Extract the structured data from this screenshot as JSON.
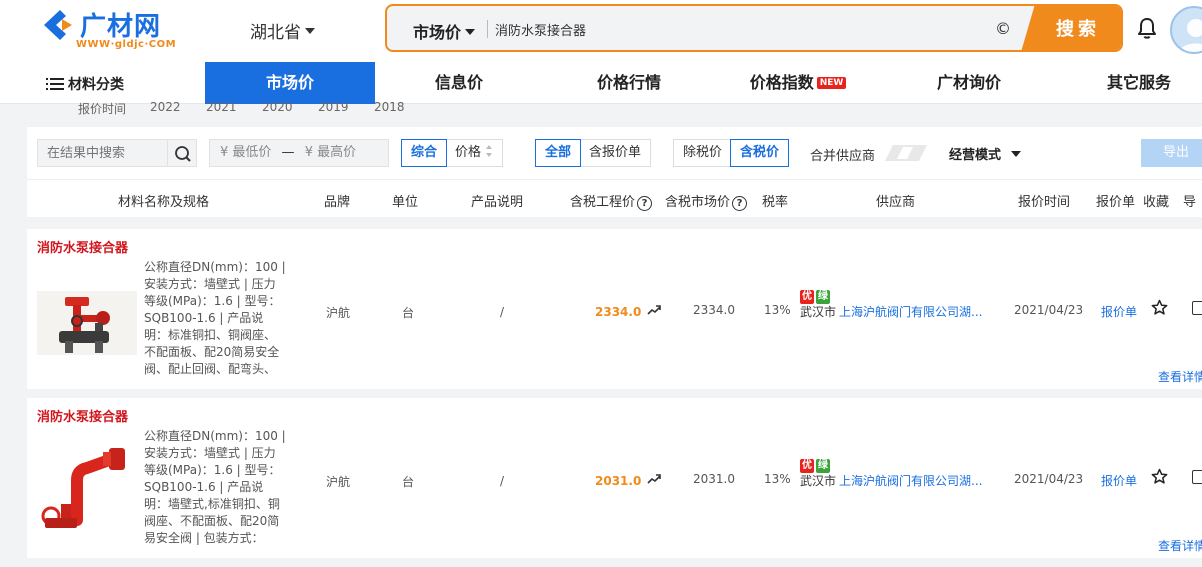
{
  "header": {
    "logo_text": "广材网",
    "logo_url": "WWW·gldjc·COM",
    "region": "湖北省",
    "search_type": "市场价",
    "search_value": "消防水泵接合器",
    "search_button": "搜索"
  },
  "nav": {
    "category_label": "材料分类",
    "items": [
      {
        "label": "市场价",
        "active": true
      },
      {
        "label": "信息价"
      },
      {
        "label": "价格行情"
      },
      {
        "label": "价格指数",
        "badge": "NEW"
      },
      {
        "label": "广材询价"
      },
      {
        "label": "其它服务"
      }
    ]
  },
  "years": {
    "label": "报价时间",
    "values": [
      "2022",
      "2021",
      "2020",
      "2019",
      "2018"
    ]
  },
  "filters": {
    "search_placeholder": "在结果中搜索",
    "price_min_placeholder": "¥ 最低价",
    "price_sep": "—",
    "price_max_placeholder": "¥ 最高价",
    "sort_comprehensive": "综合",
    "sort_price": "价格",
    "type_all": "全部",
    "type_quote": "含报价单",
    "tax_excl": "除税价",
    "tax_incl": "含税价",
    "merge_suppliers": "合并供应商",
    "business_mode": "经营模式",
    "export": "导出"
  },
  "columns": {
    "name": "材料名称及规格",
    "brand": "品牌",
    "unit": "单位",
    "desc": "产品说明",
    "eng_price": "含税工程价",
    "market_price": "含税市场价",
    "tax_rate": "税率",
    "supplier": "供应商",
    "quote_time": "报价时间",
    "quote_sheet": "报价单",
    "favorite": "收藏",
    "guide": "导"
  },
  "rows": [
    {
      "title": "消防水泵接合器",
      "spec": "公称直径DN(mm)：100 | 安装方式：墙壁式 | 压力等级(MPa)：1.6 | 型号：SQB100-1.6 | 产品说明：标准铜扣、铜阀座、不配面板、配20简易安全阀、配止回阀、配弯头、不...",
      "brand": "沪航",
      "unit": "台",
      "desc": "/",
      "eng_price": "2334.0",
      "market_price": "2334.0",
      "tax_rate": "13%",
      "tag_you": "优",
      "tag_lv": "绿",
      "city": "武汉市",
      "supplier": "上海沪航阀门有限公司湖...",
      "date": "2021/04/23",
      "quote_link": "报价单",
      "detail_link": "查看详情"
    },
    {
      "title": "消防水泵接合器",
      "spec": "公称直径DN(mm)：100 | 安装方式：墙壁式 | 压力等级(MPa)：1.6 | 型号：SQB100-1.6 | 产品说明：墙壁式,标准铜扣、铜阀座、不配面板、配20简易安全阀 | 包装方式：麻...",
      "brand": "沪航",
      "unit": "台",
      "desc": "/",
      "eng_price": "2031.0",
      "market_price": "2031.0",
      "tax_rate": "13%",
      "tag_you": "优",
      "tag_lv": "绿",
      "city": "武汉市",
      "supplier": "上海沪航阀门有限公司湖...",
      "date": "2021/04/23",
      "quote_link": "报价单",
      "detail_link": "查看详情"
    }
  ],
  "colors": {
    "brand_blue": "#1a6fe0",
    "accent_orange": "#f08a1c",
    "title_red": "#d2161e"
  }
}
